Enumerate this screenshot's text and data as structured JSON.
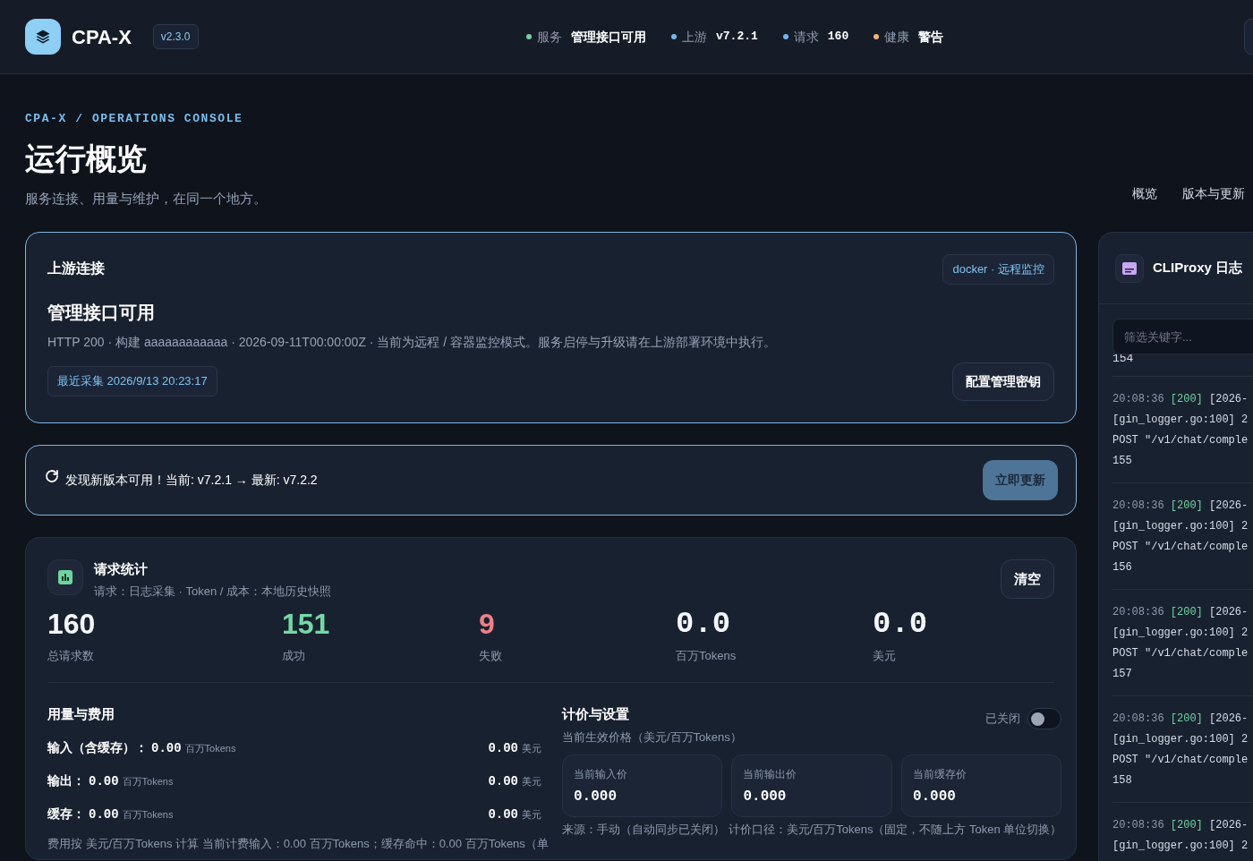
{
  "header": {
    "logo_text": "CPA-X",
    "version": "v2.3.0",
    "statuses": [
      {
        "label": "服务",
        "value": "管理接口可用",
        "color": "#6fd3a0",
        "mono": false
      },
      {
        "label": "上游",
        "value": "v7.2.1",
        "color": "#6cb8f0",
        "mono": true
      },
      {
        "label": "请求",
        "value": "160",
        "color": "#6cb8f0",
        "mono": true
      },
      {
        "label": "健康",
        "value": "警告",
        "color": "#f0b56c",
        "mono": false
      }
    ]
  },
  "hero": {
    "breadcrumb": "CPA-X / OPERATIONS CONSOLE",
    "title": "运行概览",
    "subtitle": "服务连接、用量与维护，在同一个地方。"
  },
  "nav": [
    {
      "label": "概览"
    },
    {
      "label": "版本与更新"
    }
  ],
  "upstream": {
    "title": "上游连接",
    "badge": "docker · 远程监控",
    "status": "管理接口可用",
    "detail": "HTTP 200 · 构建 aaaaaaaaaaaa · 2026-09-11T00:00:00Z · 当前为远程 / 容器监控模式。服务启停与升级请在上游部署环境中执行。",
    "collected": "最近采集 2026/9/13 20:23:17",
    "button": "配置管理密钥"
  },
  "update": {
    "message": "发现新版本可用！当前: v7.2.1 → 最新: v7.2.2",
    "button": "立即更新"
  },
  "stats": {
    "title": "请求统计",
    "subtitle": "请求：日志采集 · Token / 成本：本地历史快照",
    "clear_button": "清空",
    "metrics": [
      {
        "value": "160",
        "label": "总请求数",
        "color": "#f4f7fb"
      },
      {
        "value": "151",
        "label": "成功",
        "color": "#74d8a4"
      },
      {
        "value": "9",
        "label": "失败",
        "color": "#f07f86"
      },
      {
        "value": "0.0",
        "label": "百万Tokens",
        "color": "#f4f7fb"
      },
      {
        "value": "0.0",
        "label": "美元",
        "color": "#f4f7fb"
      }
    ],
    "usage": {
      "title": "用量与费用",
      "rows": [
        {
          "label": "输入（含缓存）：",
          "amount": "0.00",
          "unit": "百万Tokens",
          "cost": "0.00",
          "cost_unit": "美元"
        },
        {
          "label": "输出：",
          "amount": "0.00",
          "unit": "百万Tokens",
          "cost": "0.00",
          "cost_unit": "美元"
        },
        {
          "label": "缓存：",
          "amount": "0.00",
          "unit": "百万Tokens",
          "cost": "0.00",
          "cost_unit": "美元"
        }
      ],
      "note": "费用按 美元/百万Tokens 计算 当前计费输入：0.00 百万Tokens；缓存命中：0.00 百万Tokens（单"
    },
    "pricing": {
      "title": "计价与设置",
      "subtitle": "当前生效价格（美元/百万Tokens）",
      "toggle_label": "已关闭",
      "toggle_on": false,
      "prices": [
        {
          "label": "当前输入价",
          "value": "0.000"
        },
        {
          "label": "当前输出价",
          "value": "0.000"
        },
        {
          "label": "当前缓存价",
          "value": "0.000"
        }
      ],
      "note": "来源：手动（自动同步已关闭） 计价口径：美元/百万Tokens（固定，不随上方 Token 单位切换）"
    }
  },
  "logs": {
    "title": "CLIProxy 日志",
    "filter_placeholder": "筛选关键字...",
    "partial_line": "154",
    "entries": [
      {
        "time": "20:08:36",
        "status": "[200]",
        "lines": [
          "[2026-",
          "[gin_logger.go:100] 2",
          "POST \"/v1/chat/comple",
          "155"
        ]
      },
      {
        "time": "20:08:36",
        "status": "[200]",
        "lines": [
          "[2026-",
          "[gin_logger.go:100] 2",
          "POST \"/v1/chat/comple",
          "156"
        ]
      },
      {
        "time": "20:08:36",
        "status": "[200]",
        "lines": [
          "[2026-",
          "[gin_logger.go:100] 2",
          "POST \"/v1/chat/comple",
          "157"
        ]
      },
      {
        "time": "20:08:36",
        "status": "[200]",
        "lines": [
          "[2026-",
          "[gin_logger.go:100] 2",
          "POST \"/v1/chat/comple",
          "158"
        ]
      },
      {
        "time": "20:08:36",
        "status": "[200]",
        "lines": [
          "[2026-",
          "[gin_logger.go:100] 2"
        ]
      }
    ]
  }
}
